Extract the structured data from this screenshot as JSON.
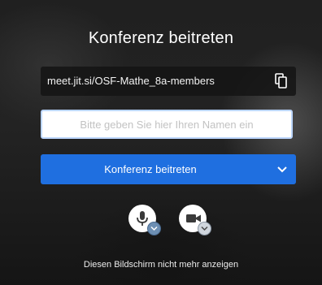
{
  "title": "Konferenz beitreten",
  "meeting_url": "meet.jit.si/OSF-Mathe_8a-members",
  "name_input": {
    "placeholder": "Bitte geben Sie hier Ihren Namen ein",
    "value": ""
  },
  "join_button": {
    "label": "Konferenz beitreten"
  },
  "dont_show_link": "Diesen Bildschirm nicht mehr anzeigen",
  "icons": {
    "copy": "copy-icon",
    "chevron": "chevron-down-icon",
    "mic": "microphone-icon",
    "camera": "camera-icon"
  },
  "colors": {
    "accent": "#1f6fe0",
    "input_border": "#bcd6ff"
  }
}
